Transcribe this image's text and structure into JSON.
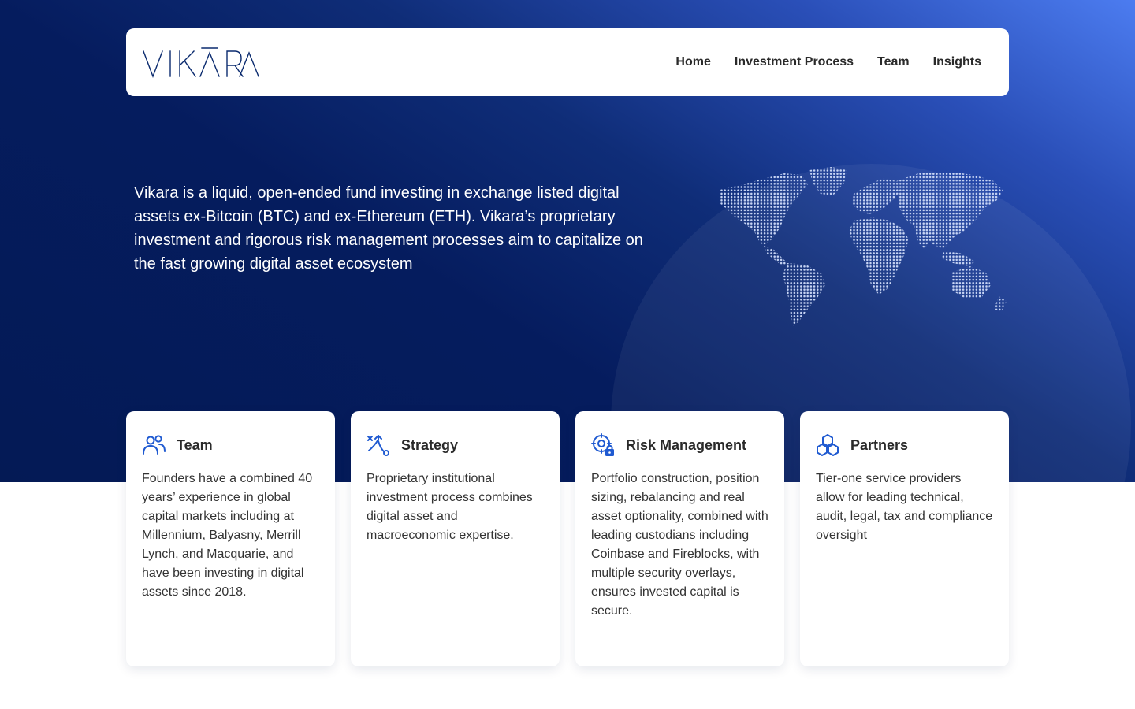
{
  "brand": {
    "logo_text": "VIKĀRA",
    "primary": "#0a2a6e",
    "accent": "#1f5ad1"
  },
  "nav": {
    "items": [
      {
        "label": "Home"
      },
      {
        "label": "Investment Process"
      },
      {
        "label": "Team"
      },
      {
        "label": "Insights"
      }
    ]
  },
  "hero": {
    "text": "Vikara is a liquid, open-ended fund investing in exchange listed digital assets ex-Bitcoin (BTC) and ex-Ethereum (ETH). Vikara’s proprietary investment and rigorous risk management processes aim to capitalize on the fast growing digital asset ecosystem",
    "image_icon": "dotted-world-map"
  },
  "cards": [
    {
      "title": "Team",
      "icon": "team-icon",
      "body": "Founders have a combined 40 years’ experience in global capital markets including at Millennium, Balyasny, Merrill Lynch, and Macquarie, and have been investing in digital assets since 2018."
    },
    {
      "title": "Strategy",
      "icon": "strategy-icon",
      "body": "Proprietary institutional investment process combines digital asset and macroeconomic expertise."
    },
    {
      "title": "Risk Management",
      "icon": "risk-management-icon",
      "body": "Portfolio construction, position sizing, rebalancing and real asset optionality, combined with leading custodians including Coinbase and Fireblocks, with multiple security overlays, ensures invested capital is secure."
    },
    {
      "title": "Partners",
      "icon": "partners-icon",
      "body": "Tier-one service providers allow for leading technical, audit, legal, tax and compliance oversight"
    }
  ]
}
